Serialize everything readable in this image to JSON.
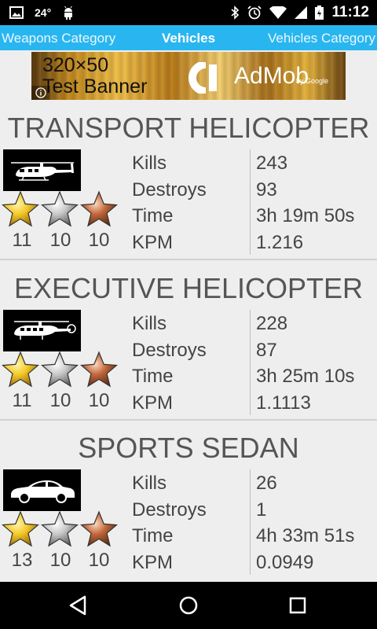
{
  "status_bar": {
    "temperature": "24°",
    "time": "11:12",
    "icons": [
      "image-icon",
      "android-icon",
      "bluetooth-icon",
      "alarm-icon",
      "wifi-icon",
      "signal-icon",
      "battery-icon"
    ]
  },
  "tabs": {
    "left": "Weapons Category",
    "center": "Vehicles",
    "right": "Vehicles Category"
  },
  "banner": {
    "line1": "320×50",
    "line2": "Test Banner",
    "brand": "AdMob",
    "brand_sub": "by Google"
  },
  "vehicles": [
    {
      "name": "TRANSPORT HELICOPTER",
      "image": "transport-helicopter",
      "medals": {
        "gold": "11",
        "silver": "10",
        "bronze": "10"
      },
      "stats": [
        {
          "label": "Kills",
          "value": "243"
        },
        {
          "label": "Destroys",
          "value": "93"
        },
        {
          "label": "Time",
          "value": "3h 19m 50s"
        },
        {
          "label": "KPM",
          "value": "1.216"
        }
      ]
    },
    {
      "name": "EXECUTIVE HELICOPTER",
      "image": "executive-helicopter",
      "medals": {
        "gold": "11",
        "silver": "10",
        "bronze": "10"
      },
      "stats": [
        {
          "label": "Kills",
          "value": "228"
        },
        {
          "label": "Destroys",
          "value": "87"
        },
        {
          "label": "Time",
          "value": "3h 25m 10s"
        },
        {
          "label": "KPM",
          "value": "1.1113"
        }
      ]
    },
    {
      "name": "SPORTS SEDAN",
      "image": "sports-sedan",
      "medals": {
        "gold": "13",
        "silver": "10",
        "bronze": "10"
      },
      "stats": [
        {
          "label": "Kills",
          "value": "26"
        },
        {
          "label": "Destroys",
          "value": "1"
        },
        {
          "label": "Time",
          "value": "4h 33m 51s"
        },
        {
          "label": "KPM",
          "value": "0.0949"
        }
      ]
    }
  ],
  "colors": {
    "tab_bar": "#29b6f0",
    "background": "#eeeeee",
    "text": "#444444",
    "title": "#555555"
  },
  "nav": {
    "icons": [
      "back-icon",
      "home-icon",
      "recents-icon"
    ]
  }
}
